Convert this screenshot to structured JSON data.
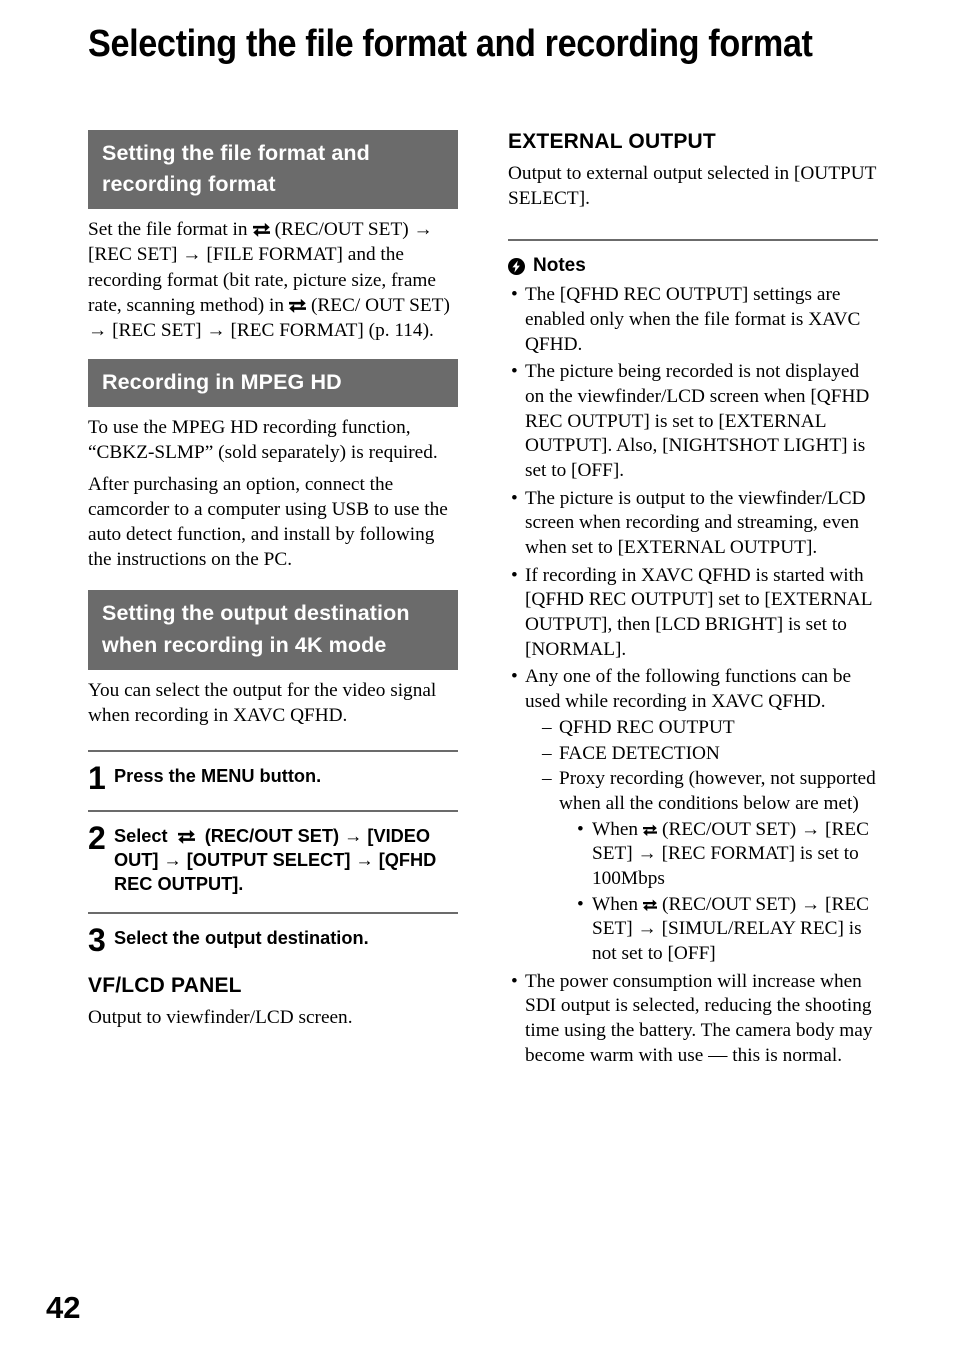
{
  "page": {
    "title": "Selecting the file format and recording format",
    "number": "42",
    "accent_gray": "#6b6b6b",
    "text_color": "#000000",
    "background": "#ffffff"
  },
  "icons": {
    "swap": "rec-out-set-swap-icon",
    "note": "note-lightning-icon",
    "arrow": "→"
  },
  "left_column": {
    "section1": {
      "heading_lines": [
        "Setting the file format and",
        "recording format"
      ],
      "paragraph_parts": {
        "p1": "Set the file format in",
        "p2": "(REC/OUT SET)",
        "p3": "→ [REC SET] → [FILE FORMAT] and the recording format (bit rate, picture size, frame rate, scanning method) in",
        "p4": "(REC/ OUT SET) → [REC SET] → [REC FORMAT] (p. 114)."
      }
    },
    "section2": {
      "heading_lines": [
        "Recording in MPEG HD"
      ],
      "paragraph1": "To use the MPEG HD recording function, “CBKZ-SLMP” (sold separately) is required.",
      "paragraph2": "After purchasing an option, connect the camcorder to a computer using USB to use the auto detect function, and install by following the instructions on the PC."
    },
    "section3": {
      "heading_lines": [
        "Setting the output destination",
        "when recording in 4K mode"
      ],
      "paragraph1": "You can select the output for the video signal when recording in XAVC QFHD."
    },
    "steps": [
      {
        "number": "1",
        "text": "Press the MENU button."
      },
      {
        "number": "2",
        "text_before_icon": "Select",
        "text_after_icon": "(REC/OUT SET) → [VIDEO OUT] → [OUTPUT SELECT] → [QFHD REC OUTPUT]."
      },
      {
        "number": "3",
        "text": "Select the output destination."
      }
    ],
    "vf_lcd": {
      "subheading": "VF/LCD PANEL",
      "paragraph": "Output to viewfinder/LCD screen."
    }
  },
  "right_column": {
    "external_output": {
      "subheading": "EXTERNAL OUTPUT",
      "paragraph": "Output to external output selected in [OUTPUT SELECT]."
    },
    "notes": {
      "heading": "Notes",
      "items": [
        {
          "text": "The [QFHD REC OUTPUT] settings are enabled only when the file format is XAVC QFHD."
        },
        {
          "text": "The picture being recorded is not displayed on the viewfinder/LCD screen when [QFHD REC OUTPUT] is set to [EXTERNAL OUTPUT]. Also, [NIGHTSHOT LIGHT] is set to [OFF]."
        },
        {
          "text": "The picture is output to the viewfinder/LCD screen when recording and streaming, even when set to [EXTERNAL OUTPUT]."
        },
        {
          "text": "If recording in XAVC QFHD is started with [QFHD REC OUTPUT] set to [EXTERNAL OUTPUT], then [LCD BRIGHT] is set to [NORMAL]."
        },
        {
          "text": "Any one of the following functions can be used while recording in XAVC QFHD.",
          "sub_items": [
            {
              "text": "QFHD REC OUTPUT"
            },
            {
              "text": "FACE DETECTION"
            },
            {
              "text": "Proxy recording (however, not supported when all the conditions below are met)",
              "conditions": [
                {
                  "before_icon": "When",
                  "after_icon": "(REC/OUT SET) → [REC SET] → [REC FORMAT] is set to 100Mbps"
                },
                {
                  "before_icon": "When",
                  "after_icon": "(REC/OUT SET) → [REC SET] → [SIMUL/RELAY REC] is not set to [OFF]"
                }
              ]
            }
          ]
        },
        {
          "text": "The power consumption will increase when SDI output is selected, reducing the shooting time using the battery. The camera body may become warm with use — this is normal."
        }
      ]
    }
  }
}
